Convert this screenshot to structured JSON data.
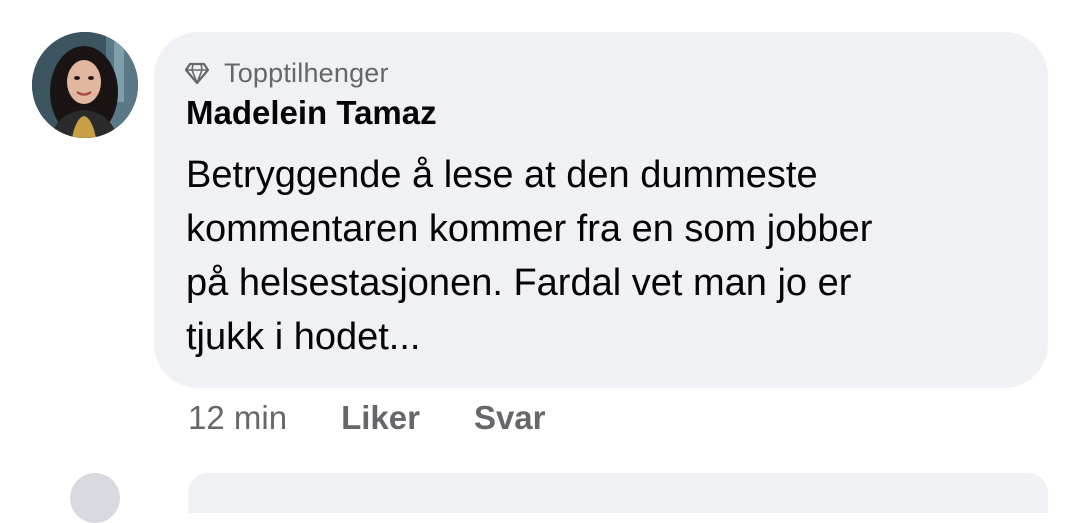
{
  "comment": {
    "badge": {
      "icon": "diamond-icon",
      "label": "Topptilhenger"
    },
    "author": "Madelein Tamaz",
    "body_lines": [
      "Betryggende å lese at den dummeste",
      "kommentaren kommer fra en som jobber",
      "på helsestasjonen. Fardal vet man jo er",
      "tjukk i hodet..."
    ],
    "time": "12 min",
    "like_label": "Liker",
    "reply_label": "Svar"
  },
  "colors": {
    "bubble_bg": "#eff1f5",
    "text_primary": "#050505",
    "text_secondary": "#65676b"
  }
}
